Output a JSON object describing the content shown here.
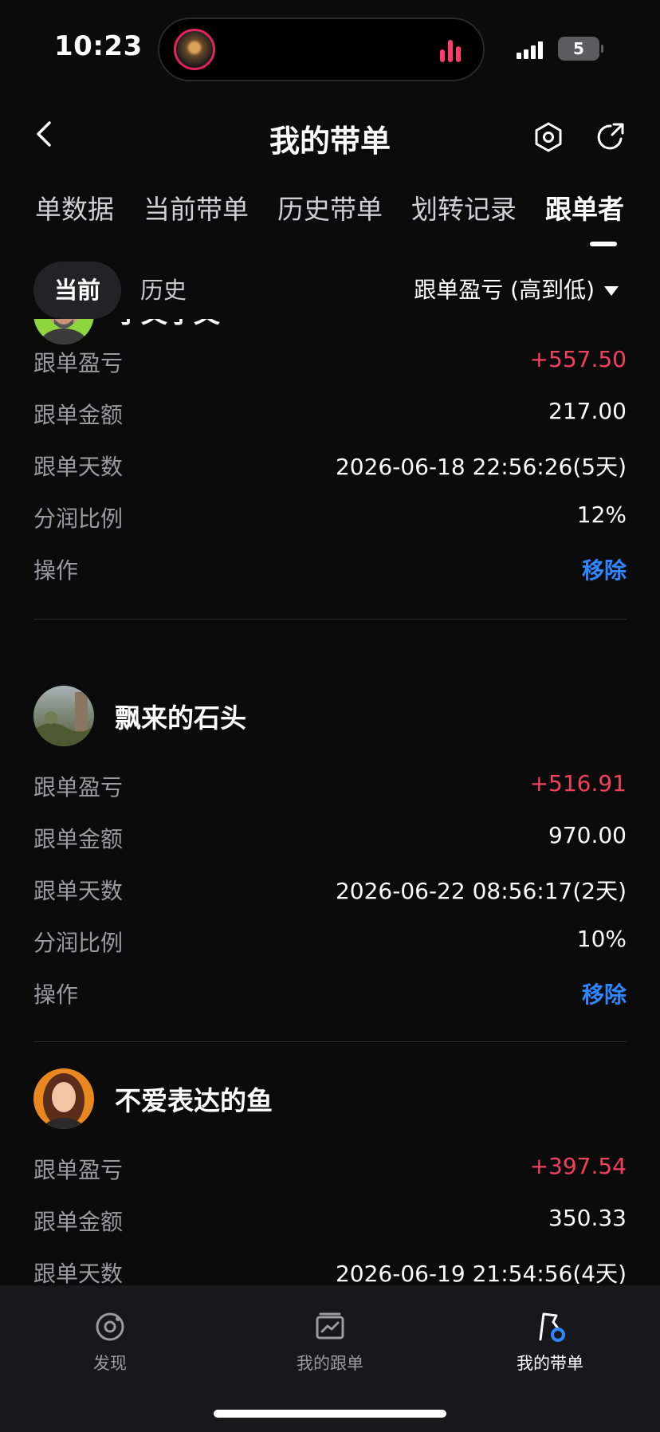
{
  "status": {
    "time": "10:23",
    "battery": "5"
  },
  "header": {
    "title": "我的带单"
  },
  "tabs": [
    {
      "label": "单数据"
    },
    {
      "label": "当前带单"
    },
    {
      "label": "历史带单"
    },
    {
      "label": "划转记录"
    },
    {
      "label": "跟单者"
    }
  ],
  "filter": {
    "current": "当前",
    "history": "历史",
    "sort": "跟单盈亏 (高到低)"
  },
  "labels": {
    "pnl": "跟单盈亏",
    "amount": "跟单金额",
    "days": "跟单天数",
    "share": "分润比例",
    "action": "操作"
  },
  "followers": [
    {
      "name": "孑文孑文",
      "pnl": "+557.50",
      "amount": "217.00",
      "days": "2026-06-18 22:56:26(5天)",
      "share": "12%",
      "action": "移除"
    },
    {
      "name": "飘来的石头",
      "pnl": "+516.91",
      "amount": "970.00",
      "days": "2026-06-22 08:56:17(2天)",
      "share": "10%",
      "action": "移除"
    },
    {
      "name": "不爱表达的鱼",
      "pnl": "+397.54",
      "amount": "350.33",
      "days": "2026-06-19 21:54:56(4天)"
    }
  ],
  "nav": [
    {
      "label": "发现",
      "icon": "discover-icon"
    },
    {
      "label": "我的跟单",
      "icon": "chart-icon"
    },
    {
      "label": "我的带单",
      "icon": "flag-icon"
    }
  ],
  "colors": {
    "profit": "#f0415e",
    "link": "#2f86ff",
    "background": "#0b0b0c"
  }
}
